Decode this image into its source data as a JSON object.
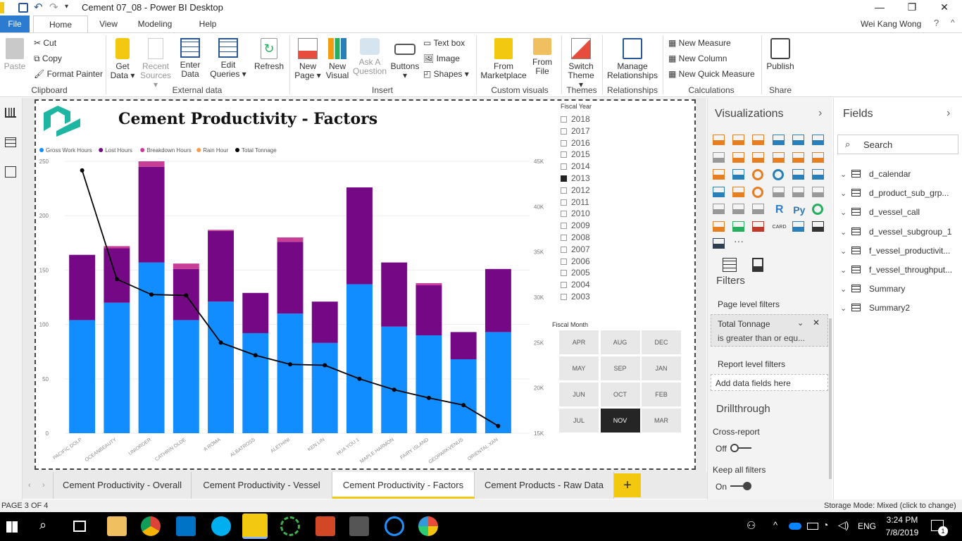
{
  "window": {
    "title": "Cement 07_08 - Power BI Desktop",
    "user": "Wei Kang Wong"
  },
  "ribbon_tabs": [
    "File",
    "Home",
    "View",
    "Modeling",
    "Help"
  ],
  "ribbon": {
    "clipboard": {
      "paste": "Paste",
      "cut": "Cut",
      "copy": "Copy",
      "format_painter": "Format Painter",
      "group": "Clipboard"
    },
    "external": {
      "get_data_1": "Get",
      "get_data_2": "Data",
      "recent_1": "Recent",
      "recent_2": "Sources",
      "enter_1": "Enter",
      "enter_2": "Data",
      "edit_1": "Edit",
      "edit_2": "Queries",
      "refresh": "Refresh",
      "group": "External data"
    },
    "insert": {
      "new_page_1": "New",
      "new_page_2": "Page",
      "new_visual_1": "New",
      "new_visual_2": "Visual",
      "ask_1": "Ask A",
      "ask_2": "Question",
      "buttons": "Buttons",
      "text_box": "Text box",
      "image": "Image",
      "shapes": "Shapes",
      "group": "Insert"
    },
    "custom": {
      "market_1": "From",
      "market_2": "Marketplace",
      "file_1": "From",
      "file_2": "File",
      "group": "Custom visuals"
    },
    "themes": {
      "switch_1": "Switch",
      "switch_2": "Theme",
      "group": "Themes"
    },
    "relationships": {
      "manage_1": "Manage",
      "manage_2": "Relationships",
      "group": "Relationships"
    },
    "calculations": {
      "new_measure": "New Measure",
      "new_column": "New Column",
      "new_quick": "New Quick Measure",
      "group": "Calculations"
    },
    "share": {
      "publish": "Publish",
      "group": "Share"
    }
  },
  "report": {
    "title": "Cement Productivity - Factors",
    "fiscal_year_label": "Fiscal Year",
    "years": [
      {
        "label": "2018",
        "checked": false
      },
      {
        "label": "2017",
        "checked": false
      },
      {
        "label": "2016",
        "checked": false
      },
      {
        "label": "2015",
        "checked": false
      },
      {
        "label": "2014",
        "checked": false
      },
      {
        "label": "2013",
        "checked": true
      },
      {
        "label": "2012",
        "checked": false
      },
      {
        "label": "2011",
        "checked": false
      },
      {
        "label": "2010",
        "checked": false
      },
      {
        "label": "2009",
        "checked": false
      },
      {
        "label": "2008",
        "checked": false
      },
      {
        "label": "2007",
        "checked": false
      },
      {
        "label": "2006",
        "checked": false
      },
      {
        "label": "2005",
        "checked": false
      },
      {
        "label": "2004",
        "checked": false
      },
      {
        "label": "2003",
        "checked": false
      }
    ],
    "fiscal_month_label": "Fiscal Month",
    "months": [
      {
        "label": "APR",
        "selected": false
      },
      {
        "label": "AUG",
        "selected": false
      },
      {
        "label": "DEC",
        "selected": false
      },
      {
        "label": "MAY",
        "selected": false
      },
      {
        "label": "SEP",
        "selected": false
      },
      {
        "label": "JAN",
        "selected": false
      },
      {
        "label": "JUN",
        "selected": false
      },
      {
        "label": "OCT",
        "selected": false
      },
      {
        "label": "FEB",
        "selected": false
      },
      {
        "label": "JUL",
        "selected": false
      },
      {
        "label": "NOV",
        "selected": true
      },
      {
        "label": "MAR",
        "selected": false
      }
    ]
  },
  "chart_data": {
    "type": "bar",
    "stacked": true,
    "categories": [
      "PACIFIC DOLP",
      "OCEANBEAUTY",
      "UNIORDER",
      "CATHRIN OLDE",
      "A ROMA",
      "ALBATROSS",
      "ALETHINI",
      "KEN LIN",
      "HUA YOU 1",
      "MAPLE HARMON",
      "FAIRY ISLAND",
      "GEOPARKVENUS",
      "ORIENTAL XAN"
    ],
    "series": [
      {
        "name": "Gross Work Hours",
        "color": "#118dff",
        "values": [
          104,
          120,
          157,
          104,
          121,
          92,
          110,
          83,
          137,
          98,
          90,
          68,
          93
        ]
      },
      {
        "name": "Lost Hours",
        "color": "#750985",
        "values": [
          60,
          50,
          88,
          47,
          65,
          37,
          66,
          38,
          89,
          59,
          46,
          25,
          58
        ]
      },
      {
        "name": "Breakdown Hours",
        "color": "#c83d95",
        "values": [
          0,
          2,
          5,
          5,
          1,
          0,
          4,
          0,
          0,
          0,
          2,
          0,
          0
        ]
      },
      {
        "name": "Rain Hour",
        "color": "#ff994e",
        "values": [
          0,
          0,
          0,
          0,
          0,
          0,
          0,
          0,
          0,
          0,
          0,
          0,
          0
        ]
      },
      {
        "name": "Total Tonnage",
        "color": "#000000",
        "type": "line",
        "axis": "right",
        "values": [
          44000,
          32000,
          30300,
          30200,
          25000,
          23600,
          22600,
          22500,
          21000,
          19800,
          18900,
          18100,
          15800
        ]
      }
    ],
    "ylim": [
      0,
      250
    ],
    "y_ticks": [
      "0",
      "50",
      "100",
      "150",
      "200",
      "250"
    ],
    "y2lim": [
      15000,
      45000
    ],
    "y2_ticks": [
      "15K",
      "20K",
      "25K",
      "30K",
      "35K",
      "40K",
      "45K"
    ],
    "legend": "top-left",
    "grid": true
  },
  "page_tabs": [
    {
      "label": "Cement Productivity - Overall",
      "active": false
    },
    {
      "label": "Cement Productivity - Vessel",
      "active": false
    },
    {
      "label": "Cement Productivity - Factors",
      "active": true
    },
    {
      "label": "Cement Products - Raw Data",
      "active": false
    }
  ],
  "add_page": "+",
  "visualizations": {
    "title": "Visualizations",
    "card_label": "CARD",
    "r_label": "R",
    "py_label": "Py"
  },
  "filters": {
    "title": "Filters",
    "page_level": "Page level filters",
    "card_title": "Total Tonnage",
    "card_condition": "is greater than or equ...",
    "report_level": "Report level filters",
    "add_fields": "Add data fields here",
    "drillthrough": "Drillthrough",
    "cross_report": "Cross-report",
    "cross_state": "Off",
    "keep_all": "Keep all filters",
    "keep_state": "On"
  },
  "fields": {
    "title": "Fields",
    "search_placeholder": "Search",
    "tables": [
      "d_calendar",
      "d_product_sub_grp...",
      "d_vessel_call",
      "d_vessel_subgroup_1",
      "f_vessel_productivit...",
      "f_vessel_throughput...",
      "Summary",
      "Summary2"
    ]
  },
  "status": {
    "page": "PAGE 3 OF 4",
    "storage": "Storage Mode: Mixed (click to change)"
  },
  "taskbar": {
    "time": "3:24 PM",
    "date": "7/8/2019",
    "lang": "ENG",
    "notif": "1"
  }
}
